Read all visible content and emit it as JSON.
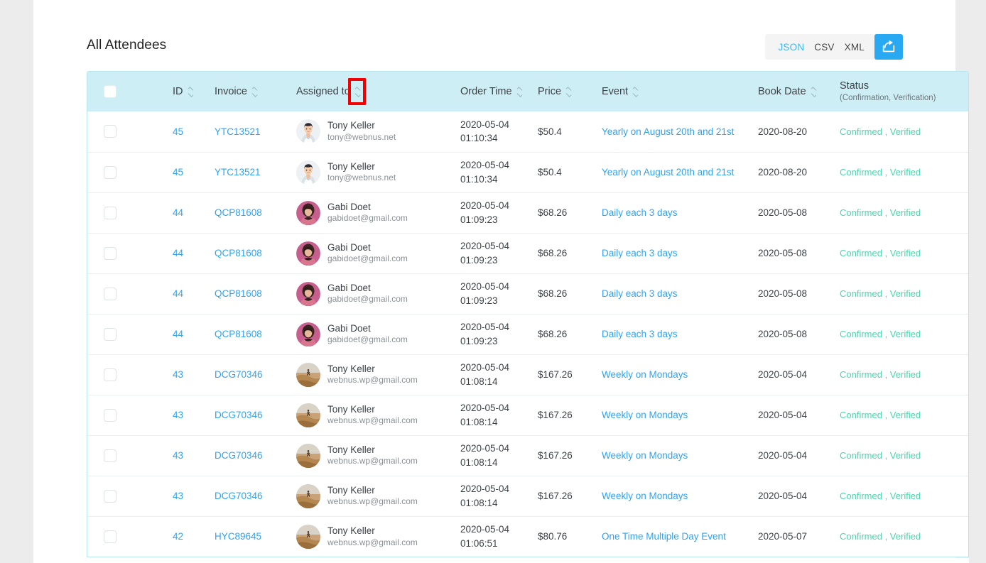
{
  "page": {
    "title": "All Attendees"
  },
  "export_bar": {
    "formats": [
      {
        "label": "JSON",
        "active": true
      },
      {
        "label": "CSV",
        "active": false
      },
      {
        "label": "XML",
        "active": false
      }
    ],
    "export_button_icon": "share-export-icon",
    "accent_color": "#28a9f2"
  },
  "table": {
    "headers": {
      "select_all": "",
      "id": "ID",
      "invoice": "Invoice",
      "assigned_to": "Assigned to",
      "order_time": "Order Time",
      "price": "Price",
      "event": "Event",
      "book_date": "Book Date",
      "status_main": "Status",
      "status_sub": "(Confirmation, Verification)"
    },
    "header_bg": "#cdeef5",
    "link_color": "#2ea3f2",
    "status_color": "#4cd6ad",
    "rows": [
      {
        "id": "45",
        "invoice": "YTC13521",
        "name": "Tony Keller",
        "email": "tony@webnus.net",
        "avatar": "avatar-cartoon-man",
        "order_date": "2020-05-04",
        "order_clock": "01:10:34",
        "price": "$50.4",
        "event": "Yearly on August 20th and 21st",
        "book_date": "2020-08-20",
        "status": "Confirmed , Verified"
      },
      {
        "id": "45",
        "invoice": "YTC13521",
        "name": "Tony Keller",
        "email": "tony@webnus.net",
        "avatar": "avatar-cartoon-man",
        "order_date": "2020-05-04",
        "order_clock": "01:10:34",
        "price": "$50.4",
        "event": "Yearly on August 20th and 21st",
        "book_date": "2020-08-20",
        "status": "Confirmed , Verified"
      },
      {
        "id": "44",
        "invoice": "QCP81608",
        "name": "Gabi Doet",
        "email": "gabidoet@gmail.com",
        "avatar": "avatar-photo-woman",
        "order_date": "2020-05-04",
        "order_clock": "01:09:23",
        "price": "$68.26",
        "event": "Daily each 3 days",
        "book_date": "2020-05-08",
        "status": "Confirmed , Verified"
      },
      {
        "id": "44",
        "invoice": "QCP81608",
        "name": "Gabi Doet",
        "email": "gabidoet@gmail.com",
        "avatar": "avatar-photo-woman",
        "order_date": "2020-05-04",
        "order_clock": "01:09:23",
        "price": "$68.26",
        "event": "Daily each 3 days",
        "book_date": "2020-05-08",
        "status": "Confirmed , Verified"
      },
      {
        "id": "44",
        "invoice": "QCP81608",
        "name": "Gabi Doet",
        "email": "gabidoet@gmail.com",
        "avatar": "avatar-photo-woman",
        "order_date": "2020-05-04",
        "order_clock": "01:09:23",
        "price": "$68.26",
        "event": "Daily each 3 days",
        "book_date": "2020-05-08",
        "status": "Confirmed , Verified"
      },
      {
        "id": "44",
        "invoice": "QCP81608",
        "name": "Gabi Doet",
        "email": "gabidoet@gmail.com",
        "avatar": "avatar-photo-woman",
        "order_date": "2020-05-04",
        "order_clock": "01:09:23",
        "price": "$68.26",
        "event": "Daily each 3 days",
        "book_date": "2020-05-08",
        "status": "Confirmed , Verified"
      },
      {
        "id": "43",
        "invoice": "DCG70346",
        "name": "Tony Keller",
        "email": "webnus.wp@gmail.com",
        "avatar": "avatar-photo-landscape",
        "order_date": "2020-05-04",
        "order_clock": "01:08:14",
        "price": "$167.26",
        "event": "Weekly on Mondays",
        "book_date": "2020-05-04",
        "status": "Confirmed , Verified"
      },
      {
        "id": "43",
        "invoice": "DCG70346",
        "name": "Tony Keller",
        "email": "webnus.wp@gmail.com",
        "avatar": "avatar-photo-landscape",
        "order_date": "2020-05-04",
        "order_clock": "01:08:14",
        "price": "$167.26",
        "event": "Weekly on Mondays",
        "book_date": "2020-05-04",
        "status": "Confirmed , Verified"
      },
      {
        "id": "43",
        "invoice": "DCG70346",
        "name": "Tony Keller",
        "email": "webnus.wp@gmail.com",
        "avatar": "avatar-photo-landscape",
        "order_date": "2020-05-04",
        "order_clock": "01:08:14",
        "price": "$167.26",
        "event": "Weekly on Mondays",
        "book_date": "2020-05-04",
        "status": "Confirmed , Verified"
      },
      {
        "id": "43",
        "invoice": "DCG70346",
        "name": "Tony Keller",
        "email": "webnus.wp@gmail.com",
        "avatar": "avatar-photo-landscape",
        "order_date": "2020-05-04",
        "order_clock": "01:08:14",
        "price": "$167.26",
        "event": "Weekly on Mondays",
        "book_date": "2020-05-04",
        "status": "Confirmed , Verified"
      },
      {
        "id": "42",
        "invoice": "HYC89645",
        "name": "Tony Keller",
        "email": "webnus.wp@gmail.com",
        "avatar": "avatar-photo-landscape",
        "order_date": "2020-05-04",
        "order_clock": "01:06:51",
        "price": "$80.76",
        "event": "One Time Multiple Day Event",
        "book_date": "2020-05-07",
        "status": "Confirmed , Verified"
      }
    ]
  },
  "annotation": {
    "type": "red-highlight-box",
    "target": "assigned-to-sort-control",
    "color": "#f40000"
  }
}
